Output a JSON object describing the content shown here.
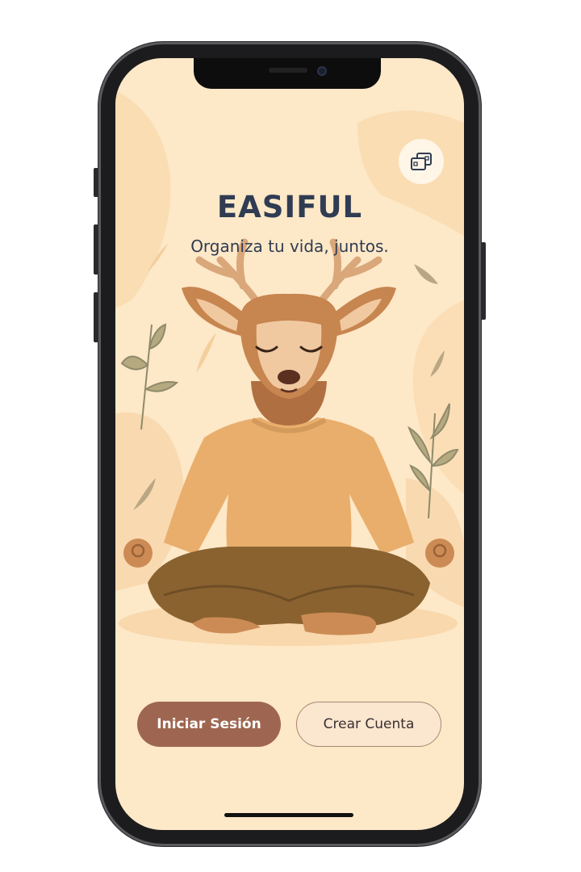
{
  "app": {
    "title": "EASIFUL",
    "tagline": "Organiza tu vida, juntos."
  },
  "actions": {
    "login_label": "Iniciar Sesión",
    "register_label": "Crear Cuenta"
  },
  "top_right_button": {
    "icon": "switch-screens-icon"
  },
  "illustration": {
    "subject": "meditating-deer-icon"
  },
  "colors": {
    "background": "#fde8c8",
    "title_text": "#2f3c52",
    "primary_button": "#9e6650",
    "secondary_button": "#fbe6d0"
  }
}
